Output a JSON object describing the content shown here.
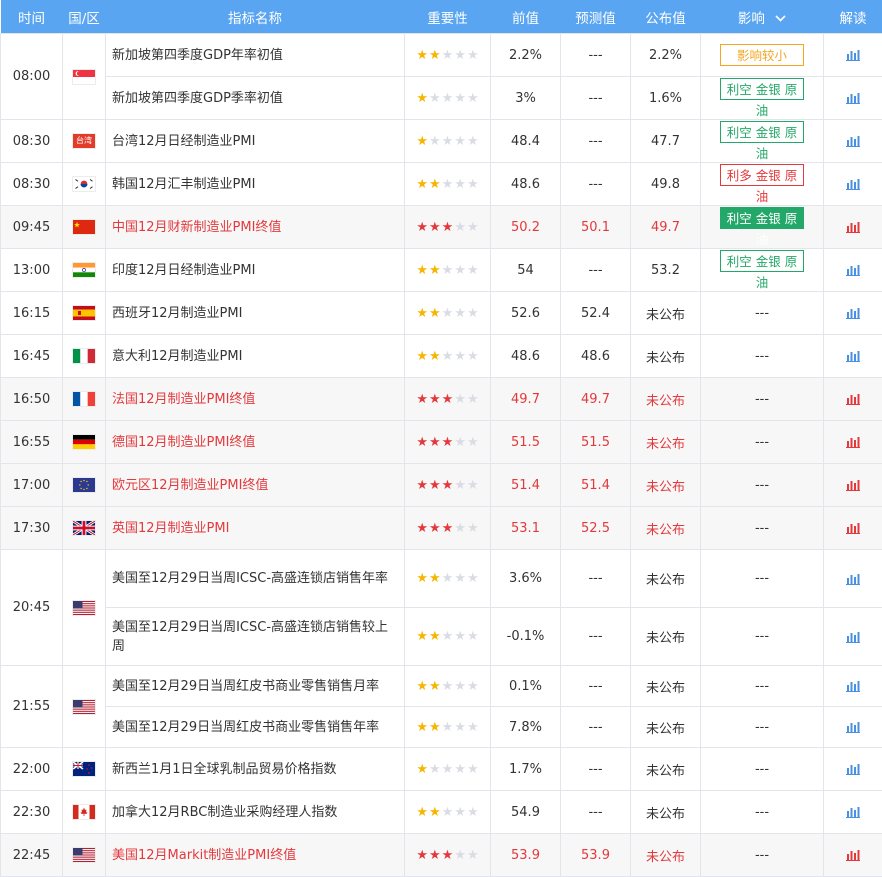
{
  "header": {
    "time": "时间",
    "country": "国/区",
    "name": "指标名称",
    "importance": "重要性",
    "previous": "前值",
    "forecast": "预测值",
    "actual": "公布值",
    "impact": "影响",
    "analysis": "解读"
  },
  "colors": {
    "header_bg": "#5aa5f2",
    "star_gold": "#f7b500",
    "star_red": "#e4393c",
    "bearish_green": "#24a869",
    "bullish_red": "#e4393c",
    "small_impact_orange": "#f5a623",
    "chart_icon_blue": "#4a90e2"
  },
  "rows": [
    {
      "time": "08:00",
      "time_rowspan": 2,
      "flag": "sg",
      "name": "新加坡第四季度GDP年率初值",
      "stars": 2,
      "previous": "2.2%",
      "forecast": "---",
      "actual": "2.2%",
      "impact": "影响较小",
      "impact_style": "orange",
      "important": false
    },
    {
      "flag_skip": true,
      "name": "新加坡第四季度GDP季率初值",
      "stars": 1,
      "previous": "3%",
      "forecast": "---",
      "actual": "1.6%",
      "impact": "利空 金银 原油",
      "impact_style": "green",
      "important": false
    },
    {
      "time": "08:30",
      "flag": "tw",
      "flag_text": "台湾",
      "name": "台湾12月日经制造业PMI",
      "stars": 1,
      "previous": "48.4",
      "forecast": "---",
      "actual": "47.7",
      "impact": "利空 金银 原油",
      "impact_style": "green",
      "important": false
    },
    {
      "time": "08:30",
      "flag": "kr",
      "name": "韩国12月汇丰制造业PMI",
      "stars": 2,
      "previous": "48.6",
      "forecast": "---",
      "actual": "49.8",
      "impact": "利多 金银 原油",
      "impact_style": "red",
      "important": false
    },
    {
      "time": "09:45",
      "flag": "cn",
      "name": "中国12月财新制造业PMI终值",
      "stars": 3,
      "previous": "50.2",
      "forecast": "50.1",
      "actual": "49.7",
      "impact": "利空 金银 原油",
      "impact_style": "solid",
      "important": true
    },
    {
      "time": "13:00",
      "flag": "in",
      "name": "印度12月日经制造业PMI",
      "stars": 2,
      "previous": "54",
      "forecast": "---",
      "actual": "53.2",
      "impact": "利空 金银 原油",
      "impact_style": "green",
      "important": false
    },
    {
      "time": "16:15",
      "flag": "es",
      "name": "西班牙12月制造业PMI",
      "stars": 2,
      "previous": "52.6",
      "forecast": "52.4",
      "actual": "未公布",
      "impact": "---",
      "impact_style": "none",
      "important": false
    },
    {
      "time": "16:45",
      "flag": "it",
      "name": "意大利12月制造业PMI",
      "stars": 2,
      "previous": "48.6",
      "forecast": "48.6",
      "actual": "未公布",
      "impact": "---",
      "impact_style": "none",
      "important": false
    },
    {
      "time": "16:50",
      "flag": "fr",
      "name": "法国12月制造业PMI终值",
      "stars": 3,
      "previous": "49.7",
      "forecast": "49.7",
      "actual": "未公布",
      "impact": "---",
      "impact_style": "none",
      "important": true
    },
    {
      "time": "16:55",
      "flag": "de",
      "name": "德国12月制造业PMI终值",
      "stars": 3,
      "previous": "51.5",
      "forecast": "51.5",
      "actual": "未公布",
      "impact": "---",
      "impact_style": "none",
      "important": true
    },
    {
      "time": "17:00",
      "flag": "eu",
      "name": "欧元区12月制造业PMI终值",
      "stars": 3,
      "previous": "51.4",
      "forecast": "51.4",
      "actual": "未公布",
      "impact": "---",
      "impact_style": "none",
      "important": true
    },
    {
      "time": "17:30",
      "flag": "gb",
      "name": "英国12月制造业PMI",
      "stars": 3,
      "previous": "53.1",
      "forecast": "52.5",
      "actual": "未公布",
      "impact": "---",
      "impact_style": "none",
      "important": true
    },
    {
      "time": "20:45",
      "time_rowspan": 2,
      "flag": "us",
      "name": "美国至12月29日当周ICSC-高盛连锁店销售年率",
      "stars": 2,
      "previous": "3.6%",
      "forecast": "---",
      "actual": "未公布",
      "impact": "---",
      "impact_style": "none",
      "important": false,
      "tall": true
    },
    {
      "flag_skip": true,
      "name": "美国至12月29日当周ICSC-高盛连锁店销售较上周",
      "stars": 2,
      "previous": "-0.1%",
      "forecast": "---",
      "actual": "未公布",
      "impact": "---",
      "impact_style": "none",
      "important": false,
      "tall": true
    },
    {
      "time": "21:55",
      "time_rowspan": 2,
      "flag": "us",
      "name": "美国至12月29日当周红皮书商业零售销售月率",
      "stars": 2,
      "previous": "0.1%",
      "forecast": "---",
      "actual": "未公布",
      "impact": "---",
      "impact_style": "none",
      "important": false
    },
    {
      "flag_skip": true,
      "name": "美国至12月29日当周红皮书商业零售销售年率",
      "stars": 2,
      "previous": "7.8%",
      "forecast": "---",
      "actual": "未公布",
      "impact": "---",
      "impact_style": "none",
      "important": false
    },
    {
      "time": "22:00",
      "flag": "nz",
      "name": "新西兰1月1日全球乳制品贸易价格指数",
      "stars": 1,
      "previous": "1.7%",
      "forecast": "---",
      "actual": "未公布",
      "impact": "---",
      "impact_style": "none",
      "important": false
    },
    {
      "time": "22:30",
      "flag": "ca",
      "name": "加拿大12月RBC制造业采购经理人指数",
      "stars": 2,
      "previous": "54.9",
      "forecast": "---",
      "actual": "未公布",
      "impact": "---",
      "impact_style": "none",
      "important": false
    },
    {
      "time": "22:45",
      "flag": "us",
      "name": "美国12月Markit制造业PMI终值",
      "stars": 3,
      "previous": "53.9",
      "forecast": "53.9",
      "actual": "未公布",
      "impact": "---",
      "impact_style": "none",
      "important": true
    }
  ]
}
